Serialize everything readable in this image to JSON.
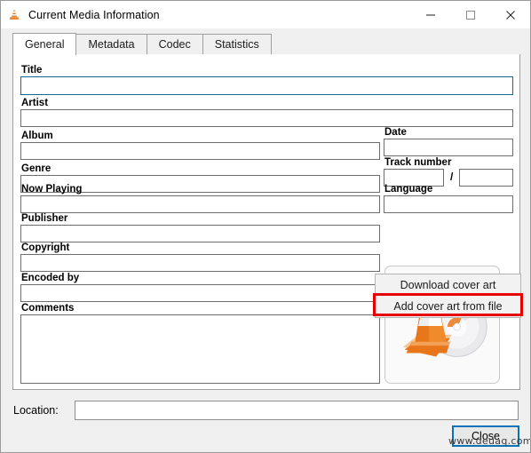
{
  "window": {
    "title": "Current Media Information",
    "icon": "vlc-cone-icon",
    "controls": {
      "minimize": "–",
      "maximize": "□",
      "close": "✕"
    }
  },
  "tabs": [
    {
      "label": "General",
      "active": true
    },
    {
      "label": "Metadata",
      "active": false
    },
    {
      "label": "Codec",
      "active": false
    },
    {
      "label": "Statistics",
      "active": false
    }
  ],
  "general": {
    "fields": [
      {
        "label": "Title",
        "value": "",
        "placeholder": ""
      },
      {
        "label": "Artist",
        "value": "",
        "placeholder": ""
      },
      {
        "label": "Album",
        "value": "",
        "placeholder": ""
      },
      {
        "label": "Genre",
        "value": "",
        "placeholder": ""
      },
      {
        "label": "Now Playing",
        "value": "",
        "placeholder": ""
      },
      {
        "label": "Publisher",
        "value": "",
        "placeholder": ""
      },
      {
        "label": "Copyright",
        "value": "",
        "placeholder": ""
      },
      {
        "label": "Encoded by",
        "value": "",
        "placeholder": ""
      },
      {
        "label": "Comments",
        "value": "",
        "placeholder": ""
      },
      {
        "label": "Date",
        "value": "",
        "placeholder": ""
      },
      {
        "label": "Track number",
        "value": "",
        "placeholder": ""
      },
      {
        "label": "Language",
        "value": "",
        "placeholder": ""
      }
    ],
    "track_separator": "/",
    "track_total_value": ""
  },
  "cover_art": {
    "name": "default-vlc-cover-art",
    "context_menu": {
      "items": [
        {
          "label": "Download cover art",
          "highlighted": false
        },
        {
          "label": "Add cover art from file",
          "highlighted": true
        }
      ],
      "highlight_color": "#e60000"
    }
  },
  "footer": {
    "location_label": "Location:",
    "location_value": "",
    "close_label": "Close",
    "watermark": "www.deuaq.com"
  },
  "colors": {
    "focus_border": "#0d6a93",
    "default_button_border": "#0a73b8",
    "accent_orange": "#e8761b"
  }
}
